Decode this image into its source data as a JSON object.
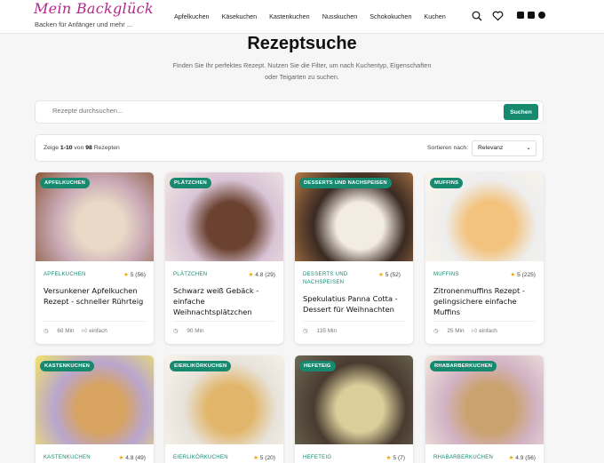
{
  "header": {
    "logo": "Mein Backglück",
    "tagline": "Backen für Anfänger und mehr ...",
    "nav": [
      "Apfelkuchen",
      "Käsekuchen",
      "Kastenkuchen",
      "Nusskuchen",
      "Schokokuchen",
      "Kuchen"
    ],
    "icons": [
      "search-icon",
      "heart-icon",
      "facebook-icon",
      "instagram-icon",
      "pinterest-icon"
    ]
  },
  "hero": {
    "title": "Rezeptsuche",
    "subtitle": "Finden Sie Ihr perfektes Rezept. Nutzen Sie die Filter, um nach Kuchentyp, Eigenschaften oder Teigarten zu suchen."
  },
  "search": {
    "placeholder": "Rezepte durchsuchen...",
    "button": "Suchen"
  },
  "results": {
    "prefix": "Zeige",
    "range": "1-10",
    "of": "von",
    "total": "98",
    "suffix": "Rezepten",
    "sort_label": "Sortieren nach:",
    "sort_value": "Relevanz"
  },
  "cards": [
    {
      "badge": "APFELKUCHEN",
      "category": "APFELKUCHEN",
      "rating": "5",
      "count": "(56)",
      "title": "Versunkener Apfelkuchen Rezept - schneller Rührteig",
      "time": "60 Min",
      "difficulty": "einfach",
      "colors": [
        "#c9a9b6",
        "#e9d9c6",
        "#8a5a3a"
      ]
    },
    {
      "badge": "PLÄTZCHEN",
      "category": "PLÄTZCHEN",
      "rating": "4.8",
      "count": "(29)",
      "title": "Schwarz weiß Gebäck - einfache Weihnachtsplätzchen",
      "time": "90 Min",
      "difficulty": "",
      "colors": [
        "#d9c4d6",
        "#6b4230",
        "#f1e7e2"
      ]
    },
    {
      "badge": "DESSERTS UND NACHSPEISEN",
      "category": "DESSERTS UND NACHSPEISEN",
      "rating": "5",
      "count": "(52)",
      "title": "Spekulatius Panna Cotta - Dessert für Weihnachten",
      "time": "135 Min",
      "difficulty": "",
      "colors": [
        "#3a2a22",
        "#f3ece3",
        "#b47a48"
      ]
    },
    {
      "badge": "MUFFINS",
      "category": "MUFFINS",
      "rating": "5",
      "count": "(225)",
      "title": "Zitronenmuffins Rezept - gelingsichere einfache Muffins",
      "time": "25 Min",
      "difficulty": "einfach",
      "colors": [
        "#eeeeee",
        "#f3c27c",
        "#fbf5ea"
      ]
    },
    {
      "badge": "KASTENKUCHEN",
      "category": "KASTENKUCHEN",
      "rating": "4.8",
      "count": "(49)",
      "title": "",
      "time": "",
      "difficulty": "",
      "colors": [
        "#b9a6cf",
        "#d8a35e",
        "#f1e36a"
      ]
    },
    {
      "badge": "EIERLIKÖRKUCHEN",
      "category": "EIERLIKÖRKUCHEN",
      "rating": "5",
      "count": "(20)",
      "title": "",
      "time": "",
      "difficulty": "",
      "colors": [
        "#e7e2da",
        "#e2b66a",
        "#f8f4ec"
      ]
    },
    {
      "badge": "HEFETEIG",
      "category": "HEFETEIG",
      "rating": "5",
      "count": "(7)",
      "title": "",
      "time": "",
      "difficulty": "",
      "colors": [
        "#4a3b30",
        "#d9cf9a",
        "#6b6a55"
      ]
    },
    {
      "badge": "RHABARBERKUCHEN",
      "category": "RHABARBERKUCHEN",
      "rating": "4.9",
      "count": "(56)",
      "title": "",
      "time": "",
      "difficulty": "",
      "colors": [
        "#d2b3c4",
        "#caa26d",
        "#f2e7df"
      ]
    }
  ]
}
